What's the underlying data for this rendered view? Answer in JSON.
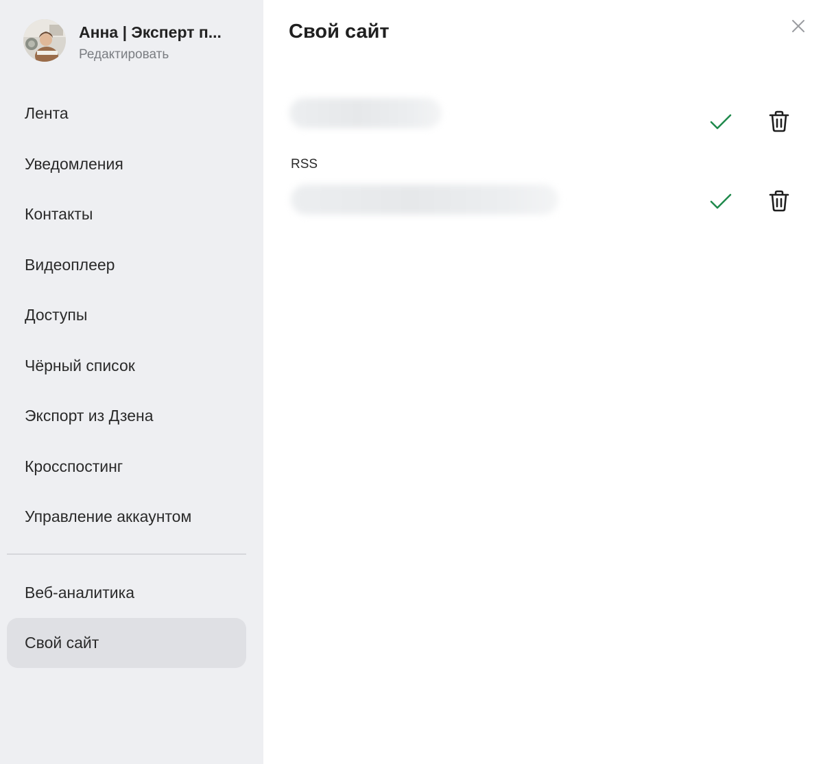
{
  "profile": {
    "name": "Анна | Эксперт п...",
    "edit_label": "Редактировать"
  },
  "sidebar": {
    "items": [
      {
        "label": "Лента",
        "active": false
      },
      {
        "label": "Уведомления",
        "active": false
      },
      {
        "label": "Контакты",
        "active": false
      },
      {
        "label": "Видеоплеер",
        "active": false
      },
      {
        "label": "Доступы",
        "active": false
      },
      {
        "label": "Чёрный список",
        "active": false
      },
      {
        "label": "Экспорт из Дзена",
        "active": false
      },
      {
        "label": "Кросспостинг",
        "active": false
      },
      {
        "label": "Управление аккаунтом",
        "active": false
      }
    ],
    "secondary_items": [
      {
        "label": "Веб-аналитика",
        "active": false
      },
      {
        "label": "Свой сайт",
        "active": true
      }
    ]
  },
  "main": {
    "title": "Свой сайт",
    "fields": [
      {
        "label": "",
        "icons": [
          "check-icon",
          "trash-icon"
        ]
      },
      {
        "label": "RSS",
        "icons": [
          "check-icon",
          "trash-icon"
        ]
      }
    ],
    "close_icon": "close-icon"
  },
  "colors": {
    "sidebar_bg": "#eeeff2",
    "active_item_bg": "#dfe0e4",
    "check_green": "#1f8a4c"
  }
}
